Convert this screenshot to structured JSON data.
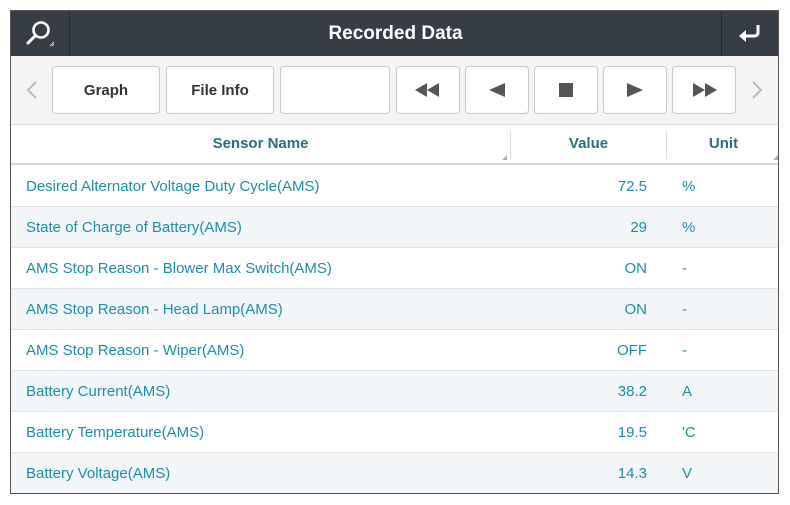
{
  "header": {
    "title": "Recorded Data",
    "search_icon": "search-icon",
    "back_icon": "return-arrow-icon"
  },
  "toolbar": {
    "prev_icon": "chevron-left-icon",
    "next_icon": "chevron-right-icon",
    "graph_label": "Graph",
    "file_info_label": "File Info",
    "blank_label": "",
    "rewind_icon": "fast-rewind-icon",
    "back_icon": "play-reverse-icon",
    "stop_icon": "stop-icon",
    "play_icon": "play-icon",
    "forward_icon": "fast-forward-icon"
  },
  "table": {
    "columns": {
      "name": "Sensor Name",
      "value": "Value",
      "unit": "Unit"
    },
    "rows": [
      {
        "name": "Desired Alternator Voltage Duty Cycle(AMS)",
        "value": "72.5",
        "unit": "%"
      },
      {
        "name": "State of Charge of Battery(AMS)",
        "value": "29",
        "unit": "%"
      },
      {
        "name": "AMS Stop Reason - Blower Max Switch(AMS)",
        "value": "ON",
        "unit": "-"
      },
      {
        "name": "AMS Stop Reason - Head Lamp(AMS)",
        "value": "ON",
        "unit": "-"
      },
      {
        "name": "AMS Stop Reason - Wiper(AMS)",
        "value": "OFF",
        "unit": "-"
      },
      {
        "name": "Battery Current(AMS)",
        "value": "38.2",
        "unit": "A"
      },
      {
        "name": "Battery Temperature(AMS)",
        "value": "19.5",
        "unit": "'C"
      },
      {
        "name": "Battery Voltage(AMS)",
        "value": "14.3",
        "unit": "V"
      }
    ]
  },
  "colors": {
    "titlebar": "#363d44",
    "accent_text": "#1f8fa3",
    "header_text": "#2a6f7e"
  }
}
